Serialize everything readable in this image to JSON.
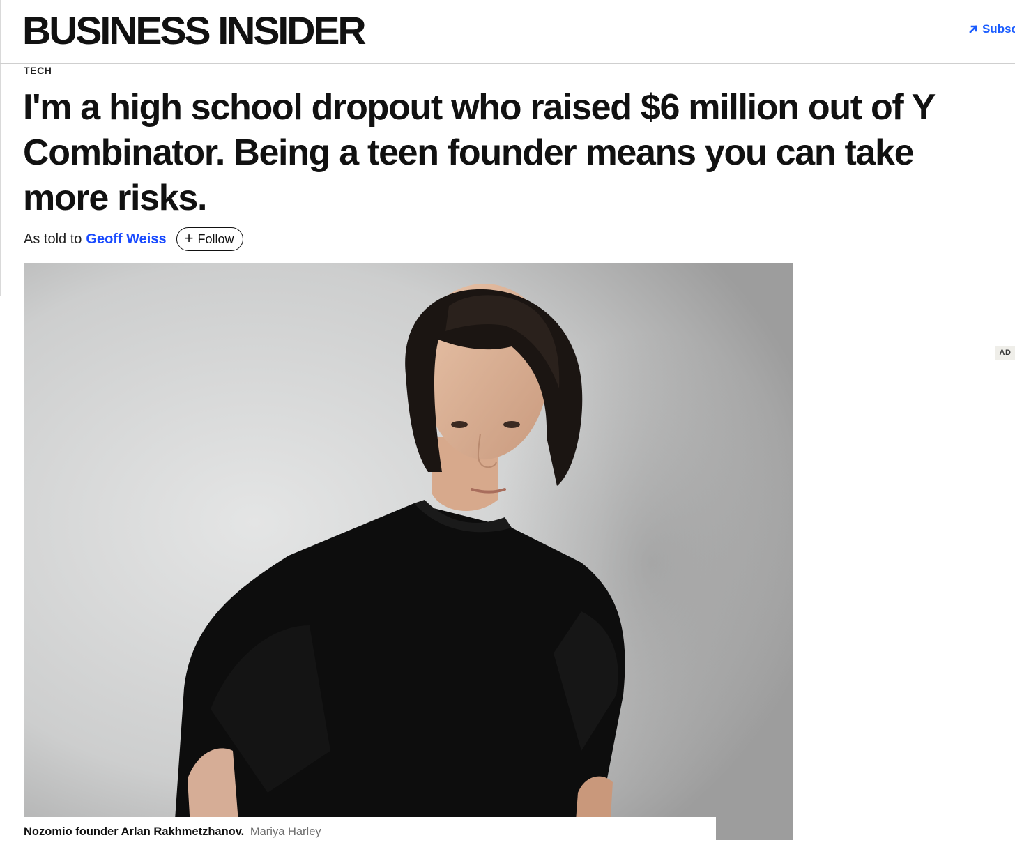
{
  "header": {
    "logo_text": "BUSINESS INSIDER",
    "subscribe_label": "Subsc"
  },
  "article": {
    "section": "TECH",
    "headline": "I'm a high school dropout who raised $6 million out of Y Combinator. Being a teen founder means you can take more risks.",
    "byline_prefix": "As told to",
    "author": "Geoff Weiss",
    "follow_label": "Follow"
  },
  "image": {
    "caption": "Nozomio founder Arlan Rakhmetzhanov.",
    "credit": "Mariya Harley"
  },
  "ad": {
    "label": "AD"
  },
  "colors": {
    "link_blue": "#1a4bff",
    "subscribe_blue": "#1a5cff",
    "text": "#111111",
    "divider": "#cfcfcf"
  },
  "icons": {
    "subscribe": "arrow-up-right-icon",
    "follow": "plus-icon"
  }
}
